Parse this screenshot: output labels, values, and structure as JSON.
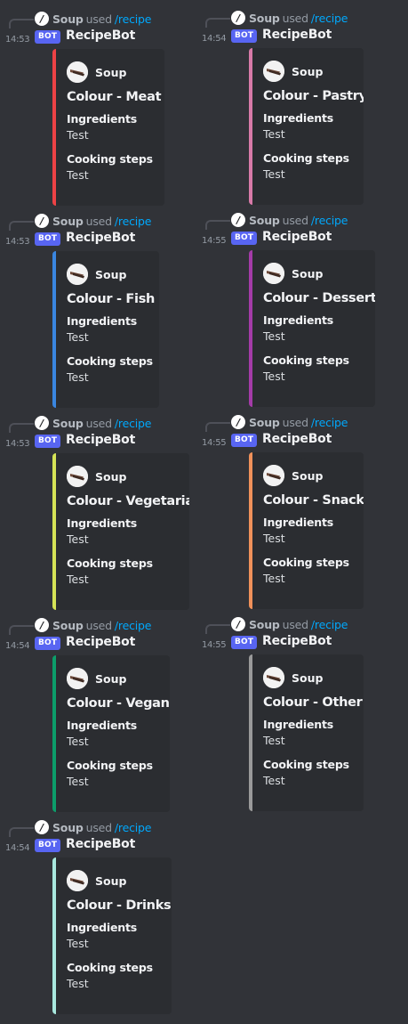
{
  "common": {
    "reply_user": "Soup",
    "reply_used": "used",
    "reply_command": "/recipe",
    "slash_glyph": "/",
    "bot_tag": "BOT",
    "bot_name": "RecipeBot",
    "author": "Soup",
    "field1_name": "Ingredients",
    "field1_value": "Test",
    "field2_name": "Cooking steps",
    "field2_value": "Test"
  },
  "messages": [
    {
      "time": "14:53",
      "title": "Colour - Meat",
      "color": "#ed4245"
    },
    {
      "time": "14:54",
      "title": "Colour - Pastry",
      "color": "#d87aa8"
    },
    {
      "time": "14:53",
      "title": "Colour - Fish",
      "color": "#3a86e0"
    },
    {
      "time": "14:55",
      "title": "Colour - Dessert",
      "color": "#a43ba8"
    },
    {
      "time": "14:53",
      "title": "Colour - Vegetarian",
      "color": "#d5e356"
    },
    {
      "time": "14:55",
      "title": "Colour - Snack",
      "color": "#f0915a"
    },
    {
      "time": "14:54",
      "title": "Colour - Vegan",
      "color": "#0c9d6a"
    },
    {
      "time": "14:55",
      "title": "Colour - Other",
      "color": "#9a9a9a"
    },
    {
      "time": "14:54",
      "title": "Colour - Drinks",
      "color": "#a8e8de"
    }
  ]
}
